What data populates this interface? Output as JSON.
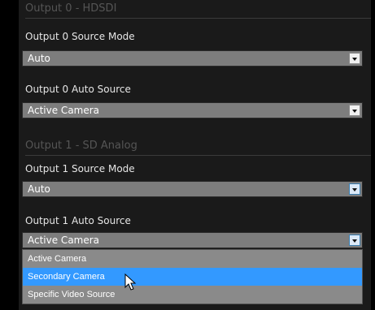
{
  "output0": {
    "section_title": "Output 0 - HDSDI",
    "source_mode_label": "Output 0 Source Mode",
    "source_mode_value": "Auto",
    "auto_source_label": "Output 0 Auto Source",
    "auto_source_value": "Active Camera"
  },
  "output1": {
    "section_title": "Output 1 - SD Analog",
    "source_mode_label": "Output 1 Source Mode",
    "source_mode_value": "Auto",
    "auto_source_label": "Output 1 Auto Source",
    "auto_source_value": "Active Camera",
    "auto_source_options": [
      "Active Camera",
      "Secondary Camera",
      "Specific Video Source"
    ],
    "highlighted_option": "Secondary Camera"
  },
  "colors": {
    "panel_background": "#1a1a1a",
    "select_background": "#7d7d7d",
    "highlight": "#3399ff",
    "section_header_text": "#555555",
    "label_text": "#e6e6e6"
  },
  "icons": {
    "dropdown_arrow": "chevron-down-icon",
    "cursor": "mouse-pointer-icon"
  }
}
